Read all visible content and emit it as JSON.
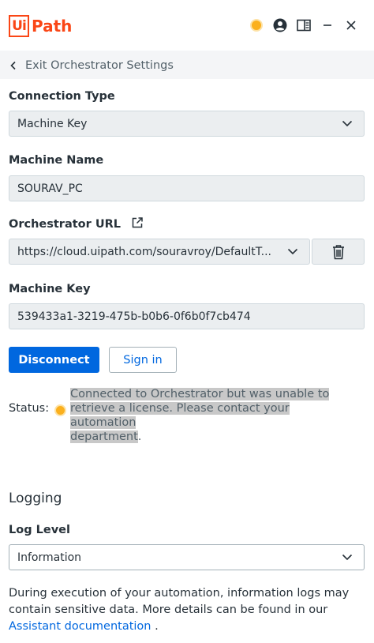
{
  "header": {
    "logo_box": "Ui",
    "logo_text": "Path",
    "status_color": "#fbb01d",
    "icons": [
      "status-dot",
      "account-icon",
      "panel-layout-icon",
      "minimize-icon",
      "close-icon"
    ]
  },
  "nav": {
    "back_label": "Exit Orchestrator Settings"
  },
  "connection": {
    "type_label": "Connection Type",
    "type_value": "Machine Key",
    "machine_name_label": "Machine Name",
    "machine_name_value": "SOURAV_PC",
    "url_label": "Orchestrator URL",
    "url_value": "https://cloud.uipath.com/souravroy/DefaultT...",
    "machine_key_label": "Machine Key",
    "machine_key_value": "539433a1-3219-475b-b0b6-0f6b0f7cb474"
  },
  "actions": {
    "disconnect": "Disconnect",
    "sign_in": "Sign in"
  },
  "status": {
    "label": "Status:",
    "message_line1": "Connected to Orchestrator but was unable to",
    "message_line2": "retrieve a license. Please contact your automation",
    "message_line3": "department",
    "message_end": ".",
    "color": "#fbb01d"
  },
  "logging": {
    "section_title": "Logging",
    "level_label": "Log Level",
    "level_value": "Information",
    "note_text": "During execution of your automation, information logs may contain sensitive data. More details can be found in our ",
    "note_link": "Assistant documentation",
    "note_end": " ."
  },
  "colors": {
    "brand": "#fa4616",
    "accent": "#0067df"
  }
}
